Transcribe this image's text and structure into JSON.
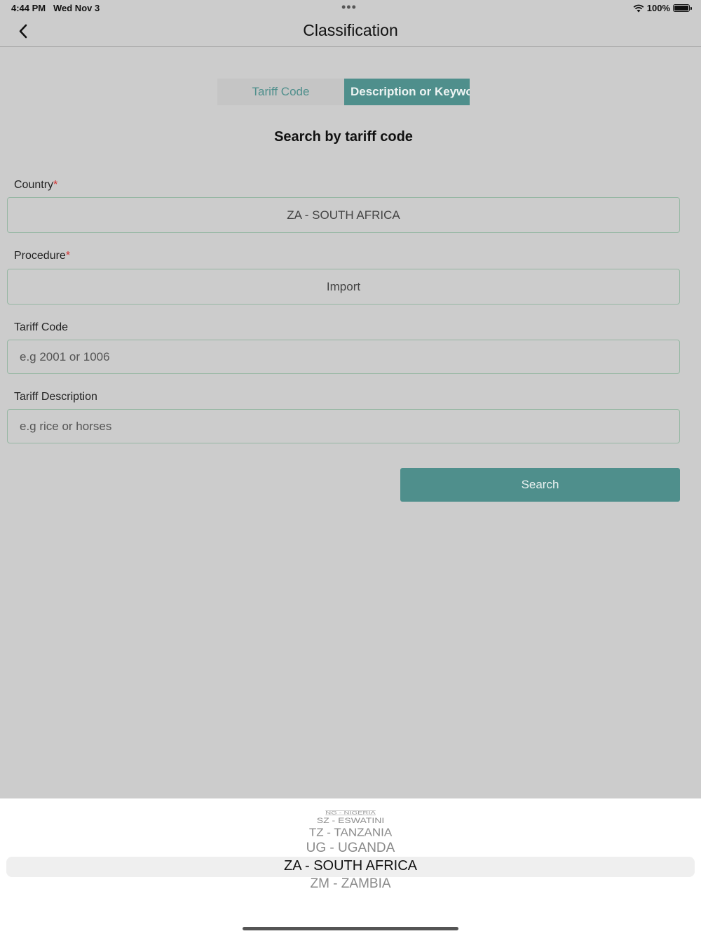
{
  "status_bar": {
    "time": "4:44 PM",
    "date": "Wed Nov 3",
    "dots": "•••",
    "battery_text": "100%"
  },
  "nav": {
    "title": "Classification",
    "back_icon": "chevron-left-icon"
  },
  "tabs": {
    "tariff_code": "Tariff Code",
    "description_keyword": "Description or Keyword",
    "active": "Description or Keyword"
  },
  "form": {
    "section_title": "Search by tariff code",
    "country_label": "Country",
    "country_value": "ZA - SOUTH AFRICA",
    "procedure_label": "Procedure",
    "procedure_value": "Import",
    "required_mark": "*",
    "tariff_code_label": "Tariff Code",
    "tariff_code_placeholder": "e.g 2001 or 1006",
    "tariff_desc_label": "Tariff Description",
    "tariff_desc_placeholder": "e.g rice or horses",
    "search_label": "Search"
  },
  "picker": {
    "items": [
      "NG - NIGERIA",
      "SZ - ESWATINI",
      "TZ - TANZANIA",
      "UG - UGANDA",
      "ZA - SOUTH AFRICA",
      "ZM - ZAMBIA"
    ],
    "selected": "ZA - SOUTH AFRICA"
  },
  "colors": {
    "accent": "#4f8f8c",
    "background": "#cccccc",
    "required": "#d32f2f"
  }
}
